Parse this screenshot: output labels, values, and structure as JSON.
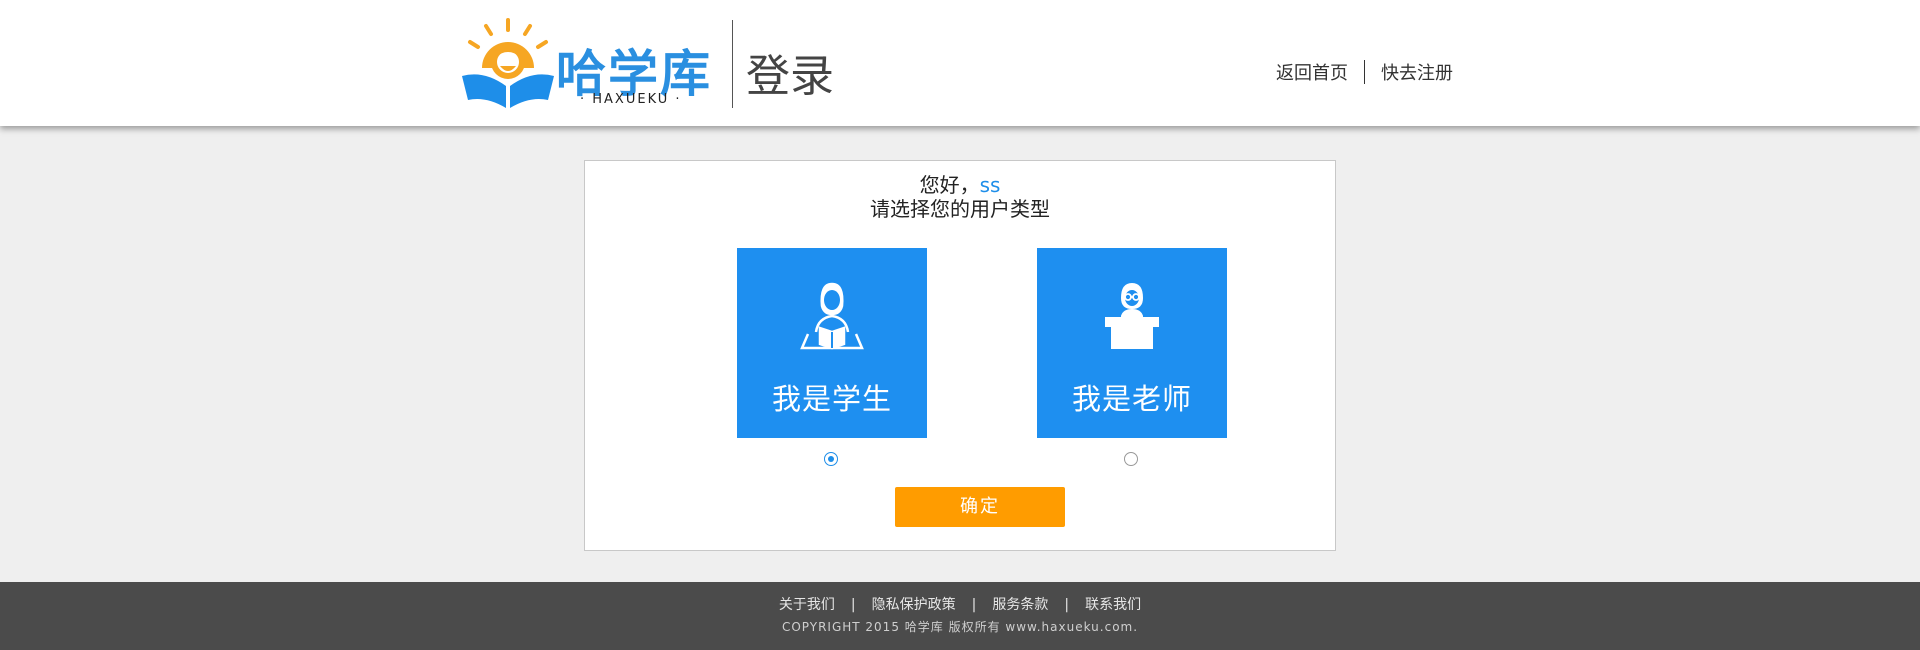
{
  "header": {
    "logo_text": "哈学库",
    "logo_subtext": "· HAXUEKU ·",
    "page_title": "登录",
    "nav": {
      "home": "返回首页",
      "register": "快去注册"
    }
  },
  "main": {
    "greeting_prefix": "您好，",
    "username": "ss",
    "prompt": "请选择您的用户类型",
    "options": [
      {
        "label": "我是学生",
        "icon": "student-reading-icon",
        "selected": true
      },
      {
        "label": "我是老师",
        "icon": "teacher-desk-icon",
        "selected": false
      }
    ],
    "confirm_label": "确定"
  },
  "footer": {
    "links": [
      "关于我们",
      "隐私保护政策",
      "服务条款",
      "联系我们"
    ],
    "copyright": "COPYRIGHT 2015  哈学库  版权所有    www.haxueku.com."
  },
  "colors": {
    "brand_blue": "#1e8ff0",
    "accent_orange": "#ff9c00",
    "logo_sun": "#f6a623",
    "footer_bg": "#4b4b4b"
  }
}
